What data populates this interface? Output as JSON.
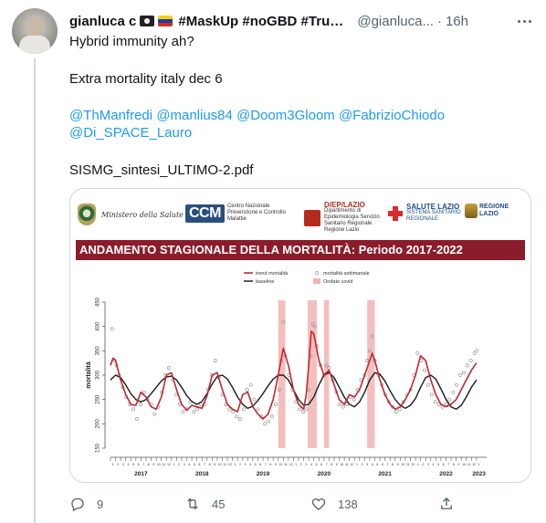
{
  "tweet": {
    "display_name": "gianluca c",
    "hashtags": "#MaskUp #noGBD #Truce Alfi...",
    "handle": "@gianluca...",
    "separator": "·",
    "time": "16h",
    "text_line_1": "Hybrid immunity ah?",
    "text_line_2": "Extra mortality italy dec 6",
    "mentions_line_1": "@ThManfredi @manlius84 @Doom3Gloom @FabrizioChiodo",
    "mentions_line_2": "@Di_SPACE_Lauro",
    "filename": "SISMG_sintesi_ULTIMO-2.pdf",
    "icons": [
      "pirate-flag-icon",
      "venezuela-flag-icon"
    ]
  },
  "media": {
    "logos": {
      "ministero": "Ministero della Salute",
      "ccm_mark": "CCM",
      "ccm_text": "Centro Nazionale Prevenzione e Controllo Malattie",
      "dep_title": "D/EP/LAZIO",
      "dep_text": "Dipartimento di Epidemiologia Servizio Sanitario Regionale Regione Lazio",
      "salute_title": "SALUTE LAZIO",
      "salute_text": "SISTEMA SANITARIO REGIONALE",
      "regione_text": "REGIONE LAZIO"
    },
    "banner": "ANDAMENTO STAGIONALE DELLA MORTALITÀ: Periodo 2017-2022"
  },
  "chart_data": {
    "type": "line",
    "title": "ANDAMENTO STAGIONALE DELLA MORTALITÀ: Periodo 2017-2022",
    "ylabel": "mortalità",
    "xlabel": "",
    "ylim": [
      150,
      450
    ],
    "yticks": [
      150,
      200,
      250,
      300,
      350,
      400,
      450
    ],
    "x_unit_months": true,
    "xlim": [
      0,
      74
    ],
    "years": [
      "2017",
      "2018",
      "2019",
      "2020",
      "2021",
      "2022",
      "2023"
    ],
    "month_tick_labels": [
      "1",
      "2",
      "3",
      "4",
      "5",
      "6",
      "7",
      "8",
      "9",
      "10",
      "11",
      "12"
    ],
    "legend": {
      "placement": "top-left",
      "entries": [
        "trend mortalità",
        "baseline",
        "mortalità settimanale",
        "Ondate covid"
      ]
    },
    "colors": {
      "trend": "#c0292f",
      "baseline": "#1a1a1a",
      "points": "#9a9a9a",
      "covid": "#f3b3b3"
    },
    "covid_waves": [
      [
        33,
        34.4
      ],
      [
        38.8,
        40.6
      ],
      [
        42,
        43
      ],
      [
        50.5,
        52
      ]
    ],
    "series": [
      {
        "name": "trend mortalità",
        "x": [
          0,
          0.5,
          1,
          2,
          3,
          4,
          5,
          6,
          7,
          8,
          9,
          10,
          11,
          12,
          13,
          14,
          15,
          16,
          17,
          18,
          19,
          20,
          21,
          22,
          23,
          24,
          25,
          26,
          27,
          28,
          29,
          30,
          31,
          32,
          33,
          34,
          35,
          36,
          37,
          38,
          38.5,
          39,
          39.5,
          40,
          41,
          42,
          43,
          44,
          45,
          46,
          47,
          48,
          49,
          50,
          51,
          51.5,
          52,
          53,
          54,
          55,
          56,
          57,
          58,
          59,
          60,
          61,
          62,
          63,
          64,
          65,
          66,
          67,
          68,
          69,
          70,
          71,
          72
        ],
        "values": [
          320,
          335,
          330,
          290,
          260,
          240,
          238,
          265,
          255,
          235,
          230,
          255,
          300,
          305,
          270,
          240,
          228,
          238,
          235,
          232,
          258,
          300,
          305,
          270,
          240,
          230,
          225,
          260,
          265,
          235,
          220,
          210,
          220,
          250,
          300,
          355,
          320,
          270,
          240,
          230,
          260,
          320,
          390,
          385,
          330,
          300,
          310,
          280,
          250,
          240,
          260,
          255,
          270,
          300,
          330,
          345,
          330,
          290,
          260,
          240,
          230,
          235,
          250,
          270,
          300,
          340,
          330,
          290,
          260,
          240,
          235,
          240,
          250,
          270,
          290,
          310,
          325
        ]
      },
      {
        "name": "baseline",
        "x": [
          0,
          1,
          2,
          3,
          4,
          5,
          6,
          7,
          8,
          9,
          10,
          11,
          12,
          13,
          14,
          15,
          16,
          17,
          18,
          19,
          20,
          21,
          22,
          23,
          24,
          25,
          26,
          27,
          28,
          29,
          30,
          31,
          32,
          33,
          34,
          35,
          36,
          37,
          38,
          39,
          40,
          41,
          42,
          43,
          44,
          45,
          46,
          47,
          48,
          49,
          50,
          51,
          52,
          53,
          54,
          55,
          56,
          57,
          58,
          59,
          60,
          61,
          62,
          63,
          64,
          65,
          66,
          67,
          68,
          69,
          70,
          71,
          72
        ],
        "values": [
          290,
          300,
          295,
          280,
          262,
          250,
          245,
          250,
          262,
          275,
          288,
          296,
          298,
          290,
          275,
          258,
          246,
          240,
          246,
          262,
          282,
          297,
          300,
          292,
          275,
          255,
          240,
          232,
          236,
          248,
          262,
          278,
          292,
          300,
          300,
          290,
          270,
          250,
          238,
          240,
          255,
          280,
          300,
          305,
          295,
          275,
          255,
          240,
          235,
          245,
          265,
          290,
          305,
          302,
          288,
          268,
          250,
          238,
          232,
          238,
          252,
          275,
          295,
          300,
          292,
          272,
          250,
          235,
          230,
          238,
          255,
          275,
          290
        ]
      },
      {
        "name": "mortalità settimanale",
        "x": [
          0.3,
          0.8,
          1.2,
          1.7,
          2.4,
          3.1,
          3.8,
          4.5,
          5.2,
          5.9,
          6.6,
          7.3,
          8.0,
          8.7,
          9.4,
          10.1,
          10.8,
          11.5,
          12.2,
          12.9,
          13.6,
          14.3,
          15.0,
          15.7,
          16.4,
          17.1,
          17.8,
          18.5,
          19.2,
          19.9,
          20.6,
          21.3,
          22.0,
          22.7,
          23.4,
          24.1,
          24.8,
          25.5,
          26.2,
          26.9,
          27.6,
          28.3,
          29.0,
          29.7,
          30.4,
          31.1,
          31.8,
          32.5,
          33.2,
          33.6,
          34.0,
          34.4,
          35.1,
          35.8,
          36.5,
          37.2,
          37.9,
          38.6,
          39.0,
          39.4,
          39.8,
          40.2,
          40.6,
          41.3,
          42.0,
          42.5,
          43.0,
          43.7,
          44.4,
          45.1,
          45.8,
          46.5,
          47.2,
          47.9,
          48.6,
          49.3,
          50.0,
          50.5,
          51.0,
          51.5,
          52.0,
          52.7,
          53.4,
          54.1,
          54.8,
          55.5,
          56.2,
          56.9,
          57.6,
          58.3,
          59.0,
          59.7,
          60.4,
          61.1,
          61.8,
          62.5,
          63.2,
          63.9,
          64.6,
          65.3,
          66.0,
          66.7,
          67.4,
          68.1,
          68.8,
          69.5,
          70.2,
          70.9,
          71.6,
          72.0
        ],
        "values": [
          395,
          330,
          320,
          300,
          275,
          255,
          240,
          230,
          210,
          240,
          265,
          250,
          240,
          220,
          235,
          265,
          300,
          315,
          290,
          260,
          240,
          225,
          230,
          245,
          225,
          230,
          240,
          240,
          270,
          300,
          330,
          295,
          260,
          240,
          230,
          225,
          215,
          210,
          230,
          270,
          280,
          250,
          230,
          215,
          200,
          205,
          215,
          240,
          270,
          330,
          410,
          340,
          300,
          270,
          245,
          230,
          225,
          230,
          270,
          340,
          405,
          400,
          360,
          320,
          300,
          320,
          315,
          290,
          265,
          240,
          235,
          240,
          255,
          250,
          270,
          290,
          300,
          330,
          350,
          380,
          330,
          300,
          280,
          260,
          245,
          235,
          225,
          230,
          245,
          260,
          270,
          300,
          345,
          330,
          310,
          280,
          260,
          245,
          240,
          235,
          240,
          250,
          265,
          280,
          300,
          305,
          320,
          330,
          345,
          350
        ]
      }
    ]
  },
  "actions": {
    "reply_count": "9",
    "retweet_count": "45",
    "like_count": "138"
  }
}
